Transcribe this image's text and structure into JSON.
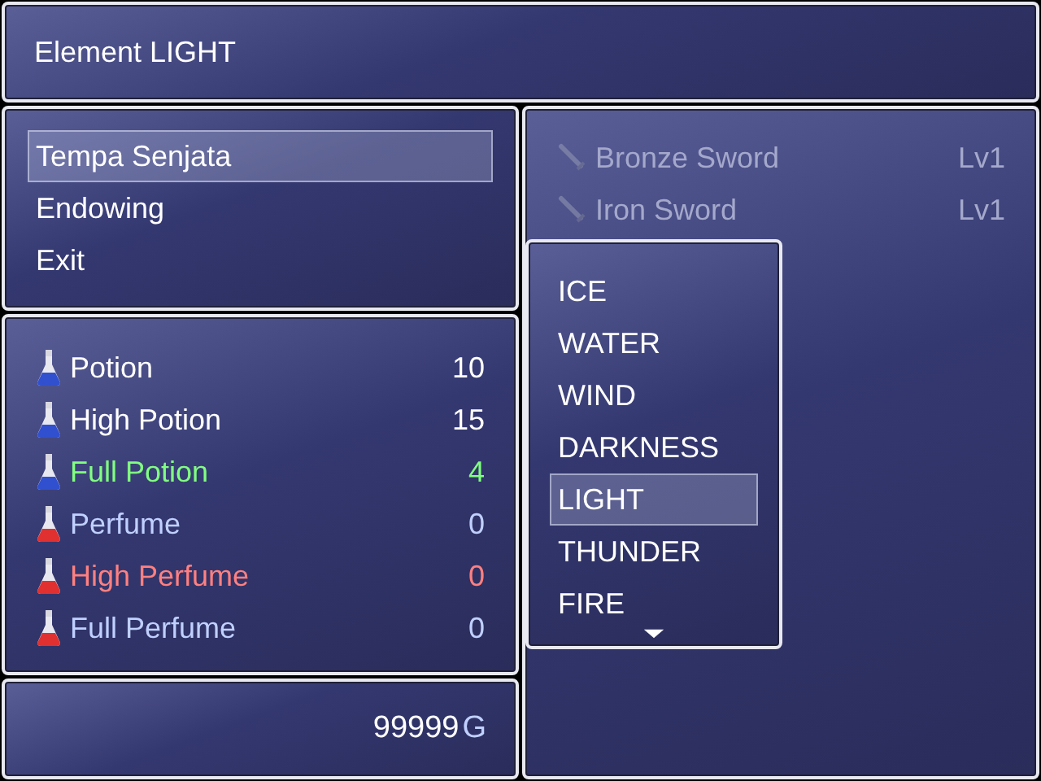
{
  "help_window": {
    "text": "Element LIGHT"
  },
  "commands": [
    {
      "label": "Tempa Senjata",
      "selected": true
    },
    {
      "label": "Endowing",
      "selected": false
    },
    {
      "label": "Exit",
      "selected": false
    }
  ],
  "items": [
    {
      "kind": "potion",
      "name": "Potion",
      "count": "10",
      "color": "#ffffff"
    },
    {
      "kind": "potion",
      "name": "High Potion",
      "count": "15",
      "color": "#ffffff"
    },
    {
      "kind": "potion",
      "name": "Full Potion",
      "count": "4",
      "color": "#80ff80"
    },
    {
      "kind": "perfume",
      "name": "Perfume",
      "count": "0",
      "color": "#c0d0ff"
    },
    {
      "kind": "perfume",
      "name": "High Perfume",
      "count": "0",
      "color": "#ff8080"
    },
    {
      "kind": "perfume",
      "name": "Full Perfume",
      "count": "0",
      "color": "#c0d0ff"
    }
  ],
  "gold": {
    "amount": "99999",
    "unit": "G"
  },
  "weapons": [
    {
      "name": "Bronze Sword",
      "level": "Lv1",
      "disabled": true
    },
    {
      "name": "Iron Sword",
      "level": "Lv1",
      "disabled": true
    }
  ],
  "elements": {
    "options": [
      {
        "label": "ICE",
        "selected": false
      },
      {
        "label": "WATER",
        "selected": false
      },
      {
        "label": "WIND",
        "selected": false
      },
      {
        "label": "DARKNESS",
        "selected": false
      },
      {
        "label": "LIGHT",
        "selected": true
      },
      {
        "label": "THUNDER",
        "selected": false
      },
      {
        "label": "FIRE",
        "selected": false
      }
    ],
    "more_below": true
  }
}
